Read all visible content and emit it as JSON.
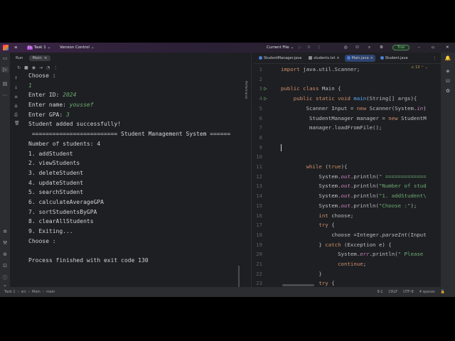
{
  "titlebar": {
    "project": "Task 1",
    "project_badge": "T1",
    "vcs": "Version Control",
    "run_config": "Current File",
    "trial": "Trial"
  },
  "run_panel": {
    "title": "Run",
    "tab": "Main",
    "side_label": "Performance"
  },
  "console": [
    {
      "text": "Choose :"
    },
    {
      "input": "1"
    },
    {
      "text": "Enter ID: ",
      "input": "2024"
    },
    {
      "text": "Enter name: ",
      "input": "youssef"
    },
    {
      "text": "Enter GPA: ",
      "input": "3"
    },
    {
      "text": "Student added successfully!"
    },
    {
      "text": " ========================= Student Management System ======"
    },
    {
      "text": "Number of students: 4"
    },
    {
      "text": "1. addStudent"
    },
    {
      "text": "2. viewStudents"
    },
    {
      "text": "3. deleteStudent"
    },
    {
      "text": "4. updateStudent"
    },
    {
      "text": "5. searchStudent"
    },
    {
      "text": "6. calculateAverageGPA"
    },
    {
      "text": "7. sortStudentsByGPA"
    },
    {
      "text": "8. clearAllStudents"
    },
    {
      "text": "9. Exiting..."
    },
    {
      "text": "Choose :"
    },
    {
      "text": ""
    },
    {
      "text": "Process finished with exit code 130"
    }
  ],
  "editor": {
    "tabs": [
      {
        "label": "StudentManager.java",
        "active": false
      },
      {
        "label": "students.txt",
        "active": false
      },
      {
        "label": "Main.java",
        "active": true
      },
      {
        "label": "Student.java",
        "active": false
      }
    ],
    "warnings": "13",
    "lines": [
      [
        [
          "import ",
          "kw"
        ],
        [
          "java.util.Scanner;",
          ""
        ]
      ],
      [],
      [
        [
          "public ",
          "kw"
        ],
        [
          "class ",
          "kw"
        ],
        [
          "Main {",
          ""
        ]
      ],
      [
        [
          "    public ",
          "kw"
        ],
        [
          "static ",
          "kw"
        ],
        [
          "void ",
          "kw"
        ],
        [
          "main",
          "fn"
        ],
        [
          "(String[] args){",
          ""
        ]
      ],
      [
        [
          "        Scanner Input = ",
          ""
        ],
        [
          "new ",
          "kw"
        ],
        [
          "Scanner(System.",
          ""
        ],
        [
          "in",
          "fld"
        ],
        [
          ")",
          ""
        ]
      ],
      [
        [
          "         StudentManager manager = ",
          ""
        ],
        [
          "new ",
          "kw"
        ],
        [
          "StudentM",
          ""
        ]
      ],
      [
        [
          "         manager.loadFromFile();",
          ""
        ]
      ],
      [],
      [],
      [],
      [
        [
          "        ",
          ""
        ],
        [
          "while ",
          "kw"
        ],
        [
          "(",
          ""
        ],
        [
          "true",
          "kw"
        ],
        [
          "){",
          ""
        ]
      ],
      [
        [
          "            System.",
          ""
        ],
        [
          "out",
          "fld"
        ],
        [
          ".println(",
          ""
        ],
        [
          "\" =============",
          "st"
        ]
      ],
      [
        [
          "            System.",
          ""
        ],
        [
          "out",
          "fld"
        ],
        [
          ".println(",
          ""
        ],
        [
          "\"Number of stud",
          "st"
        ]
      ],
      [
        [
          "            System.",
          ""
        ],
        [
          "out",
          "fld"
        ],
        [
          ".println(",
          ""
        ],
        [
          "\"1. addStudent\\",
          "st"
        ]
      ],
      [
        [
          "            System.",
          ""
        ],
        [
          "out",
          "fld"
        ],
        [
          ".println(",
          ""
        ],
        [
          "\"Choose :\"",
          "st"
        ],
        [
          ");",
          ""
        ]
      ],
      [
        [
          "            ",
          ""
        ],
        [
          "int ",
          "kw"
        ],
        [
          "choose;",
          ""
        ]
      ],
      [
        [
          "            ",
          ""
        ],
        [
          "try ",
          "kw"
        ],
        [
          "{",
          ""
        ]
      ],
      [
        [
          "                choose =Integer.",
          ""
        ],
        [
          "parseInt",
          "it2"
        ],
        [
          "(Input",
          ""
        ]
      ],
      [
        [
          "            } ",
          ""
        ],
        [
          "catch ",
          "kw"
        ],
        [
          "(Exception e) {",
          ""
        ]
      ],
      [
        [
          "                  System.",
          ""
        ],
        [
          "err",
          "fld"
        ],
        [
          ".println(",
          ""
        ],
        [
          "\" Please",
          "st"
        ]
      ],
      [
        [
          "                  ",
          ""
        ],
        [
          "continue",
          "kw"
        ],
        [
          ";",
          ""
        ]
      ],
      [
        [
          "            }",
          ""
        ]
      ],
      [
        [
          "            ",
          ""
        ],
        [
          "try ",
          "kw"
        ],
        [
          "{",
          ""
        ]
      ]
    ]
  },
  "status": {
    "breadcrumb": [
      "Task 1",
      "src",
      "Main",
      "main"
    ],
    "position": "9:1",
    "line_sep": "CRLF",
    "encoding": "UTF-8",
    "indent": "4 spaces"
  }
}
